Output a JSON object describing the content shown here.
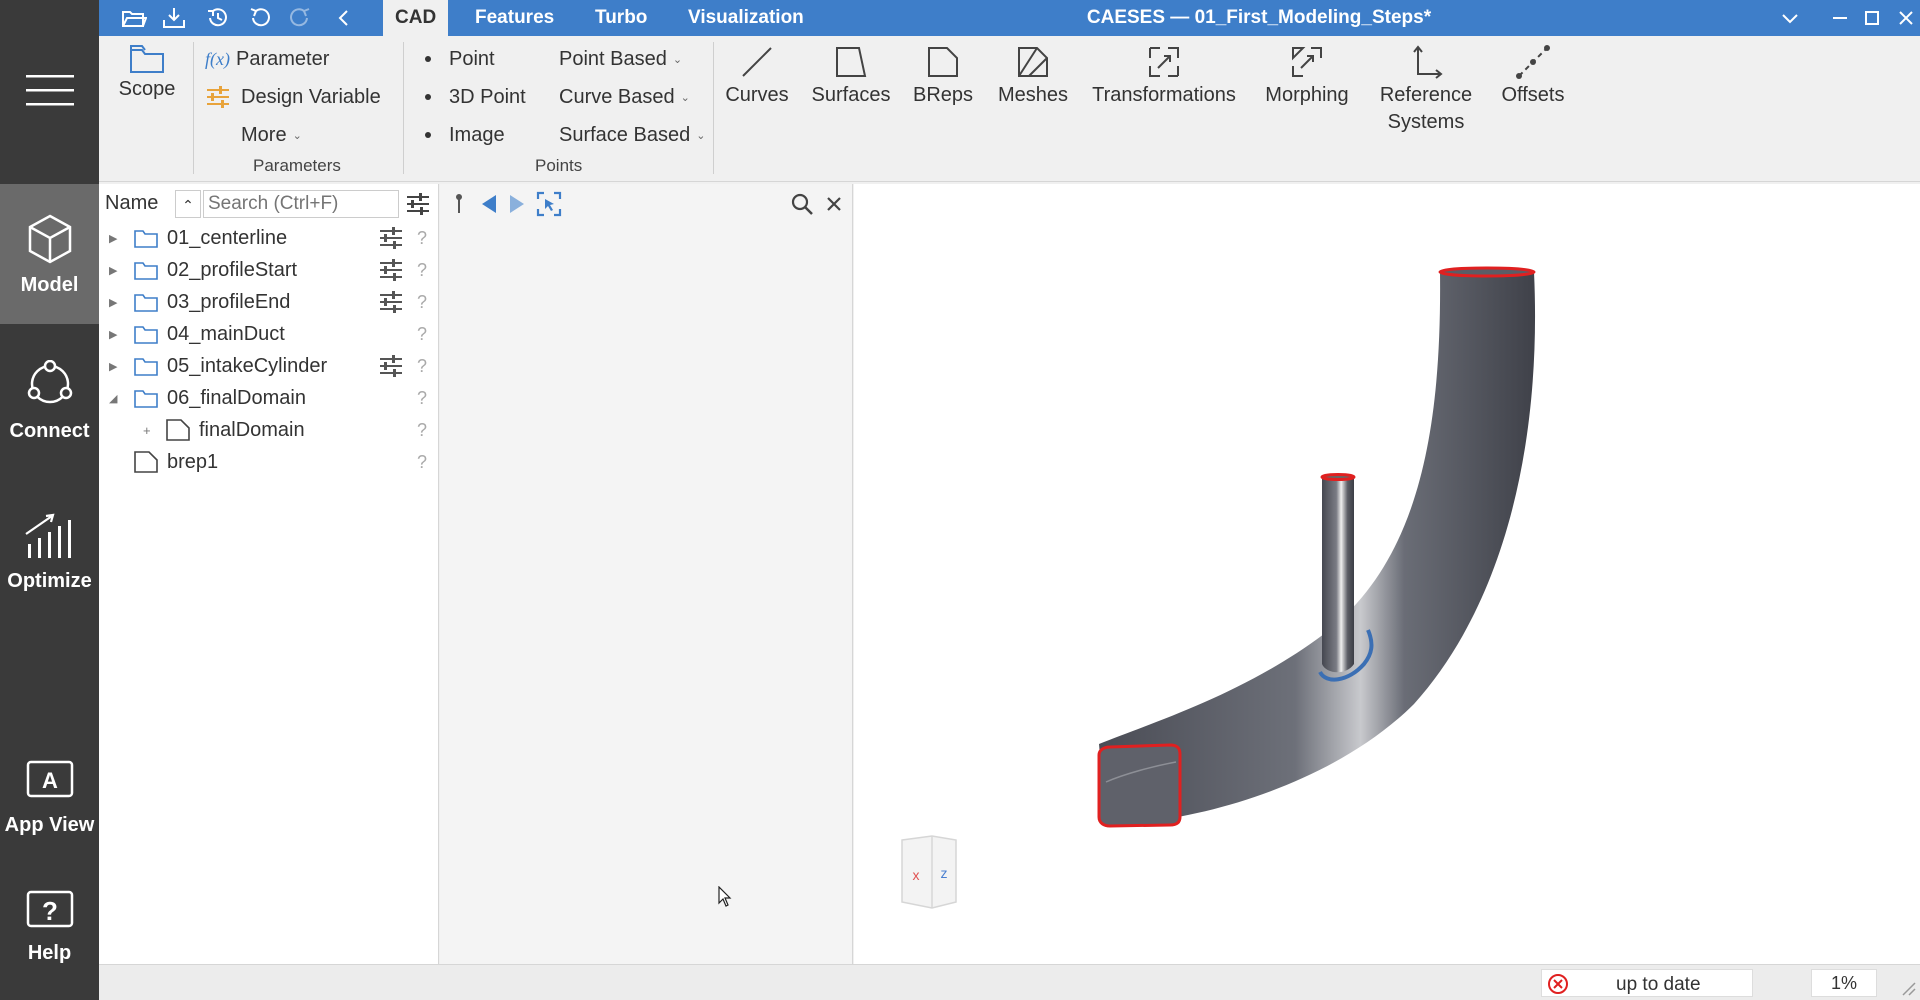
{
  "sidebar": {
    "items": [
      {
        "label": "Model",
        "icon": "cube-icon"
      },
      {
        "label": "Connect",
        "icon": "connect-icon"
      },
      {
        "label": "Optimize",
        "icon": "chart-icon"
      },
      {
        "label": "App View",
        "icon": "app-view-icon"
      },
      {
        "label": "Help",
        "icon": "help-icon"
      }
    ]
  },
  "titlebar": {
    "tabs": [
      "CAD",
      "Features",
      "Turbo",
      "Visualization"
    ],
    "window_title": "CAESES  —  01_First_Modeling_Steps*"
  },
  "ribbon": {
    "scope": "Scope",
    "parameter": "Parameter",
    "fx": "f(x)",
    "design_variable": "Design Variable",
    "more": "More",
    "parameters_group": "Parameters",
    "point": "Point",
    "point3d": "3D Point",
    "image": "Image",
    "point_based": "Point Based",
    "curve_based": "Curve Based",
    "surface_based": "Surface Based",
    "points_group": "Points",
    "curves": "Curves",
    "surfaces": "Surfaces",
    "breps": "BReps",
    "meshes": "Meshes",
    "transformations": "Transformations",
    "morphing": "Morphing",
    "reference_line1": "Reference",
    "reference_line2": "Systems",
    "offsets": "Offsets"
  },
  "tree": {
    "name_label": "Name",
    "search_placeholder": "Search (Ctrl+F)",
    "rows": [
      {
        "label": "01_centerline"
      },
      {
        "label": "02_profileStart"
      },
      {
        "label": "03_profileEnd"
      },
      {
        "label": "04_mainDuct"
      },
      {
        "label": "05_intakeCylinder"
      },
      {
        "label": "06_finalDomain"
      },
      {
        "label": "finalDomain"
      },
      {
        "label": "brep1"
      }
    ],
    "help_mark": "?"
  },
  "viewport": {
    "axis_x": "x",
    "axis_z": "z"
  },
  "status": {
    "text": "up to date",
    "progress": "1%"
  },
  "colors": {
    "titlebar": "#3e7ec9",
    "sidebar": "#3a3a3a",
    "sidebar_active": "#6a6a6a",
    "accent_orange": "#e8a33b",
    "edge_red": "#e02020"
  }
}
